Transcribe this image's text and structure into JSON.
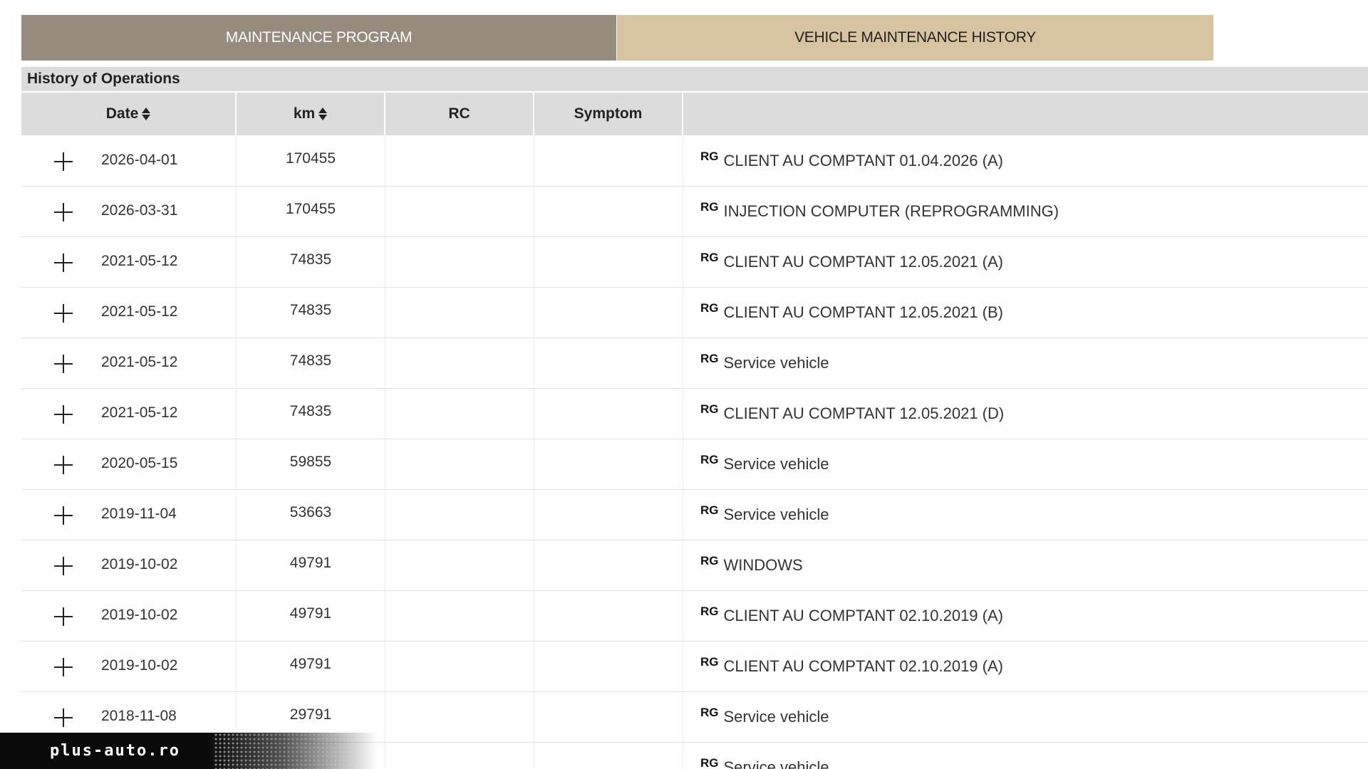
{
  "tabs": {
    "program": "MAINTENANCE PROGRAM",
    "history": "VEHICLE MAINTENANCE HISTORY",
    "active_color": "#d6c5a0",
    "inactive_color": "#978b7e"
  },
  "section": {
    "title": "History of Operations"
  },
  "table": {
    "headers": {
      "date": "Date",
      "km": "km",
      "rc": "RC",
      "symptom": "Symptom",
      "description": ""
    },
    "rows": [
      {
        "date": "2026-04-01",
        "km": "170455",
        "rc": "",
        "symptom": "",
        "tag": "RG",
        "description": "CLIENT AU COMPTANT 01.04.2026 (A)"
      },
      {
        "date": "2026-03-31",
        "km": "170455",
        "rc": "",
        "symptom": "",
        "tag": "RG",
        "description": "INJECTION COMPUTER (REPROGRAMMING)"
      },
      {
        "date": "2021-05-12",
        "km": "74835",
        "rc": "",
        "symptom": "",
        "tag": "RG",
        "description": "CLIENT AU COMPTANT 12.05.2021 (A)"
      },
      {
        "date": "2021-05-12",
        "km": "74835",
        "rc": "",
        "symptom": "",
        "tag": "RG",
        "description": "CLIENT AU COMPTANT 12.05.2021 (B)"
      },
      {
        "date": "2021-05-12",
        "km": "74835",
        "rc": "",
        "symptom": "",
        "tag": "RG",
        "description": "Service vehicle"
      },
      {
        "date": "2021-05-12",
        "km": "74835",
        "rc": "",
        "symptom": "",
        "tag": "RG",
        "description": "CLIENT AU COMPTANT 12.05.2021 (D)"
      },
      {
        "date": "2020-05-15",
        "km": "59855",
        "rc": "",
        "symptom": "",
        "tag": "RG",
        "description": "Service vehicle"
      },
      {
        "date": "2019-11-04",
        "km": "53663",
        "rc": "",
        "symptom": "",
        "tag": "RG",
        "description": "Service vehicle"
      },
      {
        "date": "2019-10-02",
        "km": "49791",
        "rc": "",
        "symptom": "",
        "tag": "RG",
        "description": "WINDOWS"
      },
      {
        "date": "2019-10-02",
        "km": "49791",
        "rc": "",
        "symptom": "",
        "tag": "RG",
        "description": "CLIENT AU COMPTANT 02.10.2019 (A)"
      },
      {
        "date": "2019-10-02",
        "km": "49791",
        "rc": "",
        "symptom": "",
        "tag": "RG",
        "description": "CLIENT AU COMPTANT 02.10.2019 (A)"
      },
      {
        "date": "2018-11-08",
        "km": "29791",
        "rc": "",
        "symptom": "",
        "tag": "RG",
        "description": "Service vehicle"
      },
      {
        "date": "",
        "km": "",
        "rc": "",
        "symptom": "",
        "tag": "RG",
        "description": "Service vehicle"
      }
    ]
  },
  "watermark": {
    "text": "plus-auto.ro"
  }
}
